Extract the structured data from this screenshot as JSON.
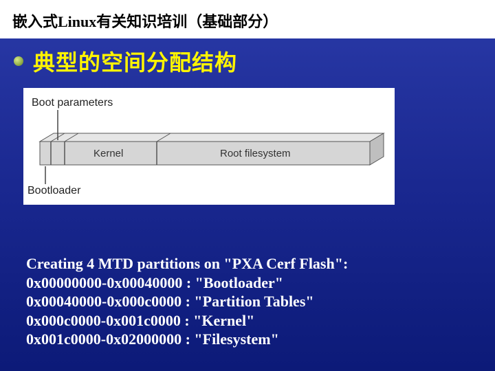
{
  "header": {
    "text": "嵌入式Linux有关知识培训（基础部分）"
  },
  "title": {
    "text": "典型的空间分配结构"
  },
  "diagram": {
    "labels": {
      "boot_params": "Boot parameters",
      "bootloader": "Bootloader",
      "kernel": "Kernel",
      "rootfs": "Root filesystem"
    }
  },
  "partitions": {
    "heading": "Creating 4 MTD partitions on \"PXA Cerf Flash\":",
    "rows": [
      {
        "start": "0x00000000",
        "end": "0x00040000",
        "name": "Bootloader"
      },
      {
        "start": "0x00040000",
        "end": "0x000c0000",
        "name": "Partition Tables"
      },
      {
        "start": "0x000c0000",
        "end": "0x001c0000",
        "name": "Kernel"
      },
      {
        "start": "0x001c0000",
        "end": "0x02000000",
        "name": "Filesystem"
      }
    ]
  }
}
